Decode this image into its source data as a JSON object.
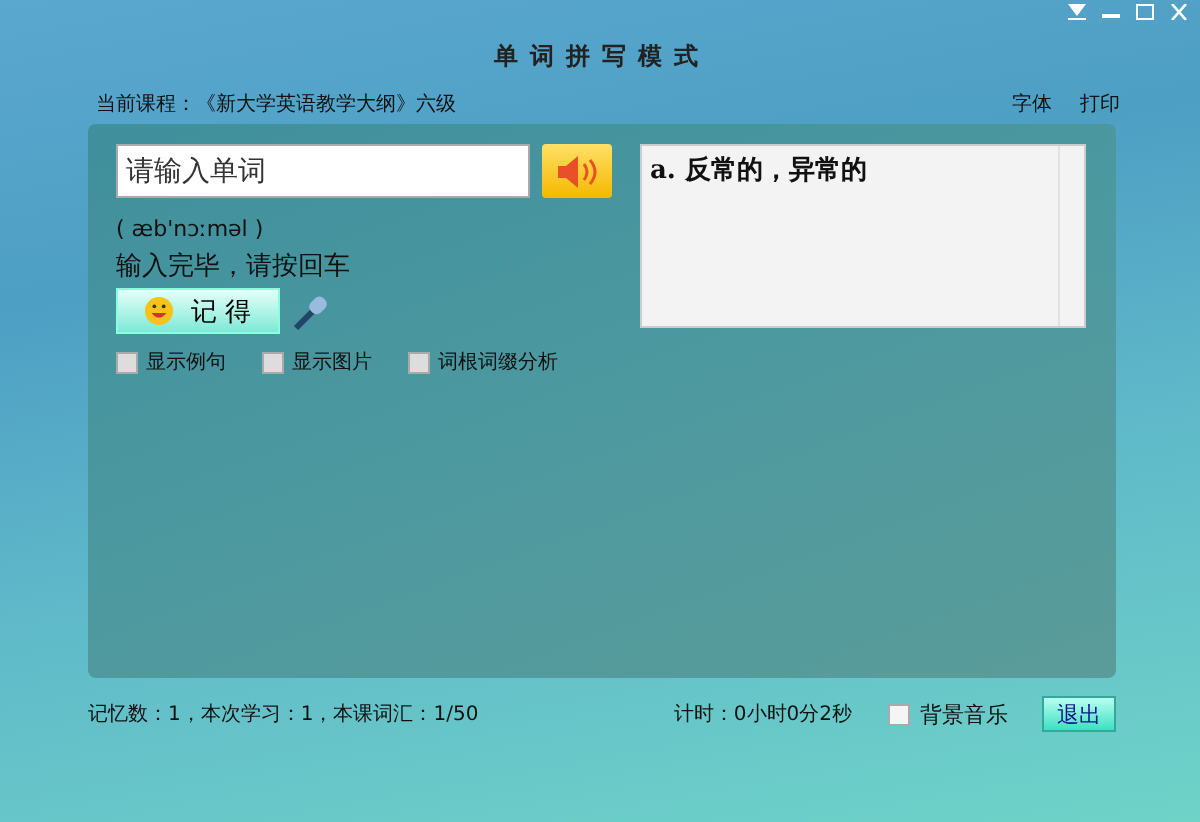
{
  "window": {
    "title": "单词拼写模式"
  },
  "header": {
    "course": "当前课程：《新大学英语教学大纲》六级",
    "links": [
      "字体",
      "打印"
    ]
  },
  "word_input": {
    "placeholder": "请输入单词"
  },
  "phonetic": "( æb'nɔːməl )",
  "prompt": "输入完毕，请按回车",
  "remember_button": "记 得",
  "definition": "a. 反常的，异常的",
  "options": [
    {
      "label": "显示例句",
      "checked": false
    },
    {
      "label": "显示图片",
      "checked": false
    },
    {
      "label": "词根词缀分析",
      "checked": false
    }
  ],
  "status": {
    "progress": "记忆数：1，本次学习：1，本课词汇：1/50",
    "timer": "计时：0小时0分2秒"
  },
  "background_music": {
    "label": "背景音乐",
    "checked": false
  },
  "exit_button": "退出"
}
